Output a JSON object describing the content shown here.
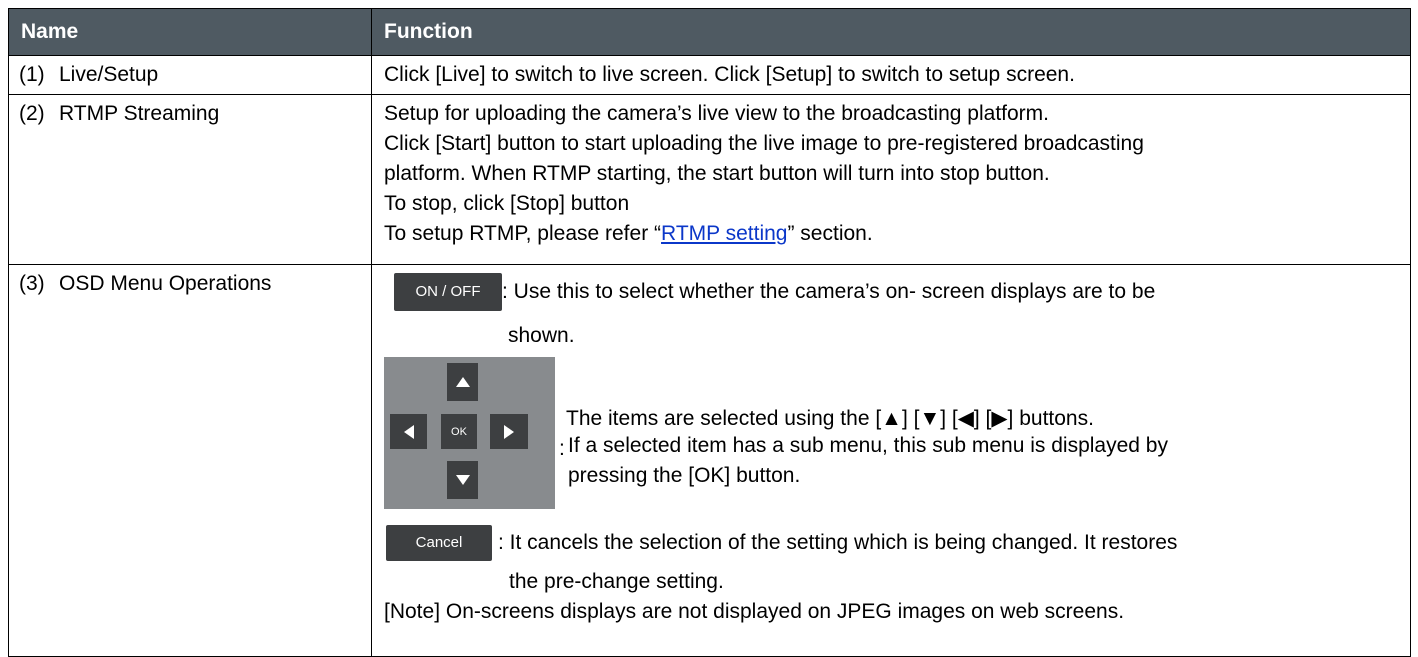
{
  "table": {
    "headers": {
      "name": "Name",
      "function": "Function"
    },
    "rows": [
      {
        "num": "(1)",
        "name": "Live/Setup",
        "lines": [
          "Click [Live] to switch to live screen. Click [Setup] to switch to setup screen."
        ]
      },
      {
        "num": "(2)",
        "name": "RTMP Streaming",
        "lines": [
          "Setup for uploading the camera’s live view to the broadcasting platform.",
          "Click [Start] button to start uploading the live image to pre-registered broadcasting",
          "platform. When RTMP starting, the start button will turn into stop button.",
          "To stop, click [Stop] button"
        ],
        "ref_prefix": "To setup RTMP, please refer “",
        "ref_link": "RTMP setting",
        "ref_suffix": "” section."
      },
      {
        "num": "(3)",
        "name": "OSD Menu Operations",
        "onoff": {
          "button": "ON / OFF",
          "desc": ": Use this to select whether the camera’s on- screen displays are to be",
          "desc2": "shown."
        },
        "dpad": {
          "ok": "OK",
          "icons": [
            "arrow-up-icon",
            "arrow-down-icon",
            "arrow-left-icon",
            "arrow-right-icon"
          ],
          "line1": "The items are selected using the [▲] [▼] [◀] [▶] buttons.",
          "colon": ":",
          "line2": "If a selected item has a sub menu, this sub menu is displayed by",
          "line3": "pressing the [OK] button."
        },
        "cancel": {
          "button": "Cancel",
          "desc": ": It cancels the selection of the setting which is being changed. It restores",
          "desc2": "the pre-change setting."
        },
        "note": "[Note] On-screens displays are not displayed on JPEG images on web screens."
      }
    ]
  },
  "colors": {
    "header_bg": "#4f5a62",
    "button_bg": "#3d3f41",
    "dpad_bg": "#888b8e",
    "link": "#0b37c9"
  }
}
